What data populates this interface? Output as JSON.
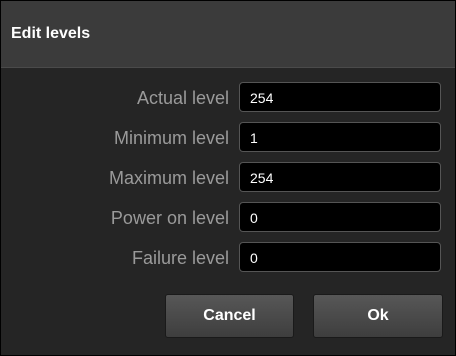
{
  "dialog": {
    "title": "Edit levels"
  },
  "fields": [
    {
      "label": "Actual level",
      "value": "254"
    },
    {
      "label": "Minimum level",
      "value": "1"
    },
    {
      "label": "Maximum level",
      "value": "254"
    },
    {
      "label": "Power on level",
      "value": "0"
    },
    {
      "label": "Failure level",
      "value": "0"
    }
  ],
  "buttons": {
    "cancel_label": "Cancel",
    "ok_label": "Ok"
  },
  "colors": {
    "titlebar_bg": "#3b3b3b",
    "body_bg": "#252525",
    "field_bg": "#000000",
    "label_text": "#9a9a9a",
    "value_text": "#ffffff"
  }
}
